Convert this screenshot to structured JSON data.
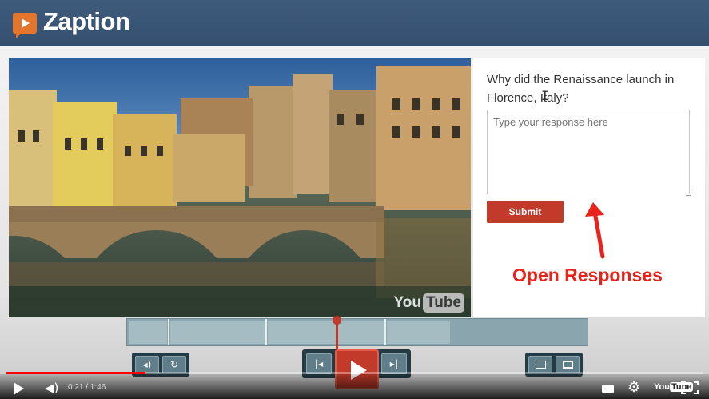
{
  "brand": {
    "name": "Zaption"
  },
  "video": {
    "watermark_you": "You",
    "watermark_tube": "Tube"
  },
  "question_panel": {
    "question": "Why did the Renaissance launch in Florence, Italy?",
    "response_placeholder": "Type your response here",
    "response_value": "",
    "submit_label": "Submit"
  },
  "annotation": {
    "label": "Open Responses",
    "color": "#e8231b"
  },
  "player": {
    "time": "0:21 / 1:46",
    "progress_fraction": 0.2,
    "youtube_logo_you": "You",
    "youtube_logo_tube": "Tube"
  },
  "icons": {
    "volume": "volume-icon",
    "replay": "replay-icon",
    "prev": "skip-back-icon",
    "play": "play-icon",
    "next": "skip-forward-icon",
    "layout": "layout-icon",
    "expand": "expand-icon",
    "captions": "captions-icon",
    "settings": "gear-icon",
    "fullscreen": "fullscreen-icon"
  },
  "colors": {
    "header": "#3f5b7b",
    "accent": "#c23a2a",
    "brand_icon": "#e3752c",
    "timeline": "#8aa5ae"
  }
}
